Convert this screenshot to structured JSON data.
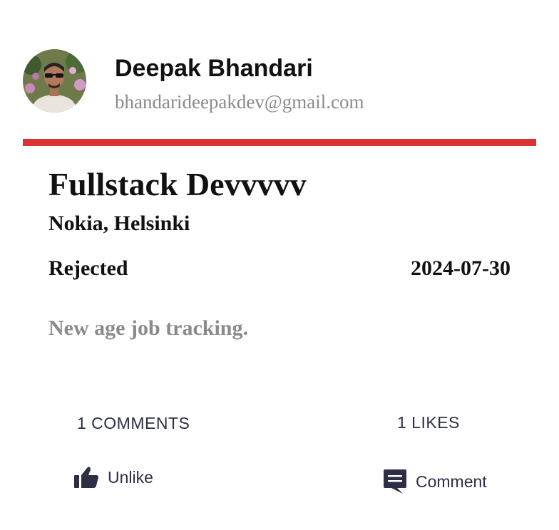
{
  "user": {
    "name": "Deepak Bhandari",
    "email": "bhandarideepakdev@gmail.com",
    "avatar_icon": "user-avatar-photo"
  },
  "accent_color": "#dc3232",
  "job": {
    "title": "Fullstack Devvvvv",
    "location": "Nokia, Helsinki",
    "status": "Rejected",
    "date": "2024-07-30",
    "description": "New age job tracking."
  },
  "stats": {
    "comments": "1 COMMENTS",
    "likes": "1 LIKES"
  },
  "actions": {
    "unlike_label": "Unlike",
    "unlike_icon": "thumbs-up-icon",
    "comment_label": "Comment",
    "comment_icon": "comment-icon"
  }
}
